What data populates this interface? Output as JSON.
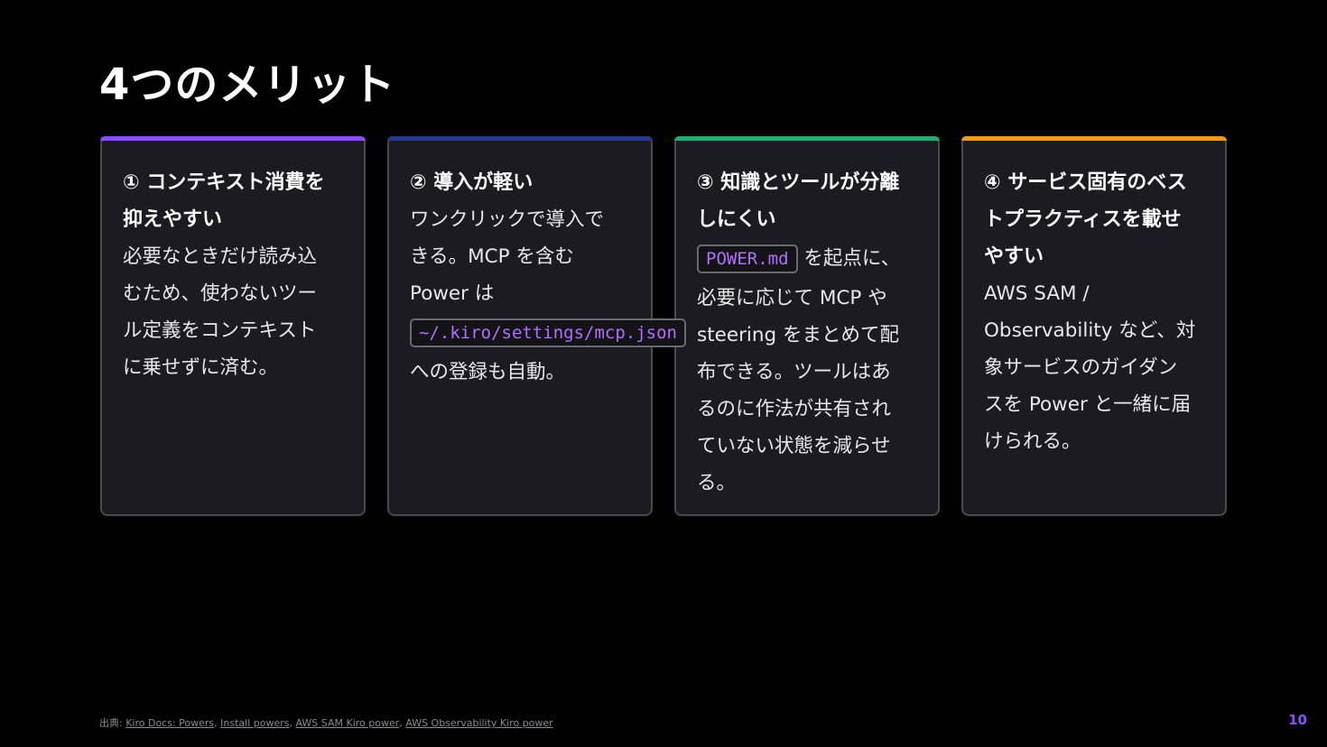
{
  "slide": {
    "title": "4つのメリット",
    "page_number": "10"
  },
  "colors": {
    "background": "#000000",
    "card_background": "#1c1b21",
    "accent_1": "#8a4dff",
    "accent_2": "#1f3a8f",
    "accent_3": "#1fae6f",
    "accent_4": "#f0971e",
    "code_text": "#b070ff"
  },
  "cards": [
    {
      "title_lines": [
        "① コンテキスト消費を",
        "抑えやすい"
      ],
      "body": {
        "l1": "必要なときだけ読み込",
        "l2": "むため、使わないツー",
        "l3": "ル定義をコンテキスト",
        "l4": "に乗せずに済む。"
      }
    },
    {
      "title_lines": [
        "② 導入が軽い"
      ],
      "body": {
        "l1": "ワンクリックで導入で",
        "l2": "きる。MCP を含む",
        "l3": "Power は",
        "code": "~/.kiro/settings/mcp.json",
        "l5": "への登録も自動。"
      }
    },
    {
      "title_lines": [
        "③ 知識とツールが分離",
        "しにくい"
      ],
      "body": {
        "code": "POWER.md",
        "l1_rest": " を起点に、",
        "l2": "必要に応じて MCP や",
        "l3": "steering をまとめて配",
        "l4": "布できる。ツールはあ",
        "l5": "るのに作法が共有され",
        "l6": "ていない状態を減らせ",
        "l7": "る。"
      }
    },
    {
      "title_lines": [
        "④ サービス固有のベス",
        "トプラクティスを載せ",
        "やすい"
      ],
      "body": {
        "l1": "AWS SAM /",
        "l2": "Observability など、対",
        "l3": "象サービスのガイダン",
        "l4": "スを Power と一緒に届",
        "l5": "けられる。"
      }
    }
  ],
  "footer": {
    "prefix": "出典: ",
    "links": [
      "Kiro Docs: Powers",
      "Install powers",
      "AWS SAM Kiro power",
      "AWS Observability Kiro power"
    ],
    "separator": ", "
  }
}
